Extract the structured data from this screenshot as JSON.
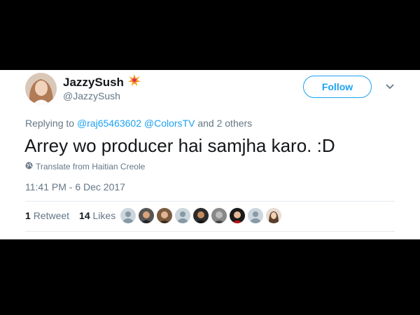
{
  "author": {
    "display_name": "JazzySush",
    "handle": "@JazzySush",
    "emoji_icon": "collision-emoji-icon"
  },
  "actions": {
    "follow_label": "Follow",
    "more_icon": "chevron-down-icon"
  },
  "reply_context": {
    "prefix": "Replying to",
    "mention_1": "@raj65463602",
    "mention_2": "@ColorsTV",
    "suffix": "and 2 others"
  },
  "tweet": {
    "text": "Arrey wo producer hai samjha karo. :D",
    "translate_label": "Translate from Haitian Creole",
    "timestamp": "11:41 PM - 6 Dec 2017"
  },
  "stats": {
    "retweets_count": "1",
    "retweets_label": "Retweet",
    "likes_count": "14",
    "likes_label": "Likes"
  },
  "colors": {
    "accent": "#1da1f2",
    "text_primary": "#14171a",
    "text_secondary": "#657786"
  }
}
